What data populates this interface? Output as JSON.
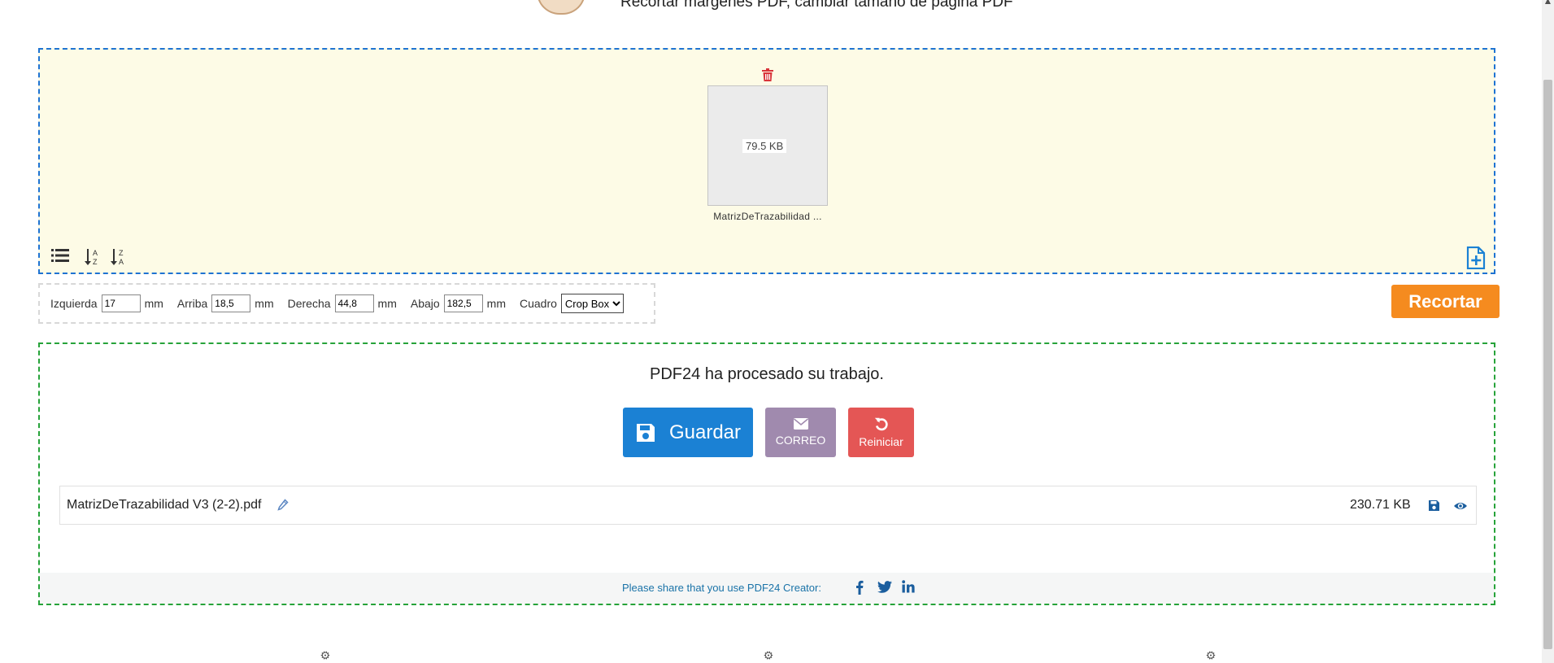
{
  "header": {
    "subtitle": "Recortar márgenes PDF, cambiar tamaño de página PDF"
  },
  "dropzone": {
    "file": {
      "size": "79.5 KB",
      "name": "MatrizDeTrazabilidad ..."
    },
    "icons": {
      "delete": "trash-icon",
      "list_view": "list-icon",
      "sort_asc": "sort-alpha-down-icon",
      "sort_desc": "sort-alpha-up-icon",
      "add_file": "file-plus-icon"
    }
  },
  "options": {
    "left": {
      "label": "Izquierda",
      "value": "17",
      "unit": "mm"
    },
    "top": {
      "label": "Arriba",
      "value": "18,5",
      "unit": "mm"
    },
    "right": {
      "label": "Derecha",
      "value": "44,8",
      "unit": "mm"
    },
    "bottom": {
      "label": "Abajo",
      "value": "182,5",
      "unit": "mm"
    },
    "box": {
      "label": "Cuadro",
      "selected": "Crop Box"
    }
  },
  "crop_button": {
    "label": "Recortar"
  },
  "result": {
    "message": "PDF24 ha procesado su trabajo.",
    "save_label": "Guardar",
    "email_label": "CORREO",
    "reset_label": "Reiniciar",
    "file": {
      "name": "MatrizDeTrazabilidad V3 (2-2).pdf",
      "size": "230.71 KB"
    }
  },
  "share": {
    "text": "Please share that you use PDF24 Creator:",
    "networks": [
      "facebook-icon",
      "twitter-icon",
      "linkedin-icon"
    ]
  },
  "colors": {
    "dropzone_border": "#1e73d2",
    "dropzone_bg": "#fdfbe6",
    "crop_button": "#f58b1f",
    "result_border": "#27a33a",
    "save_button": "#1b81d4",
    "email_button": "#a08aae",
    "reset_button": "#e45655"
  }
}
